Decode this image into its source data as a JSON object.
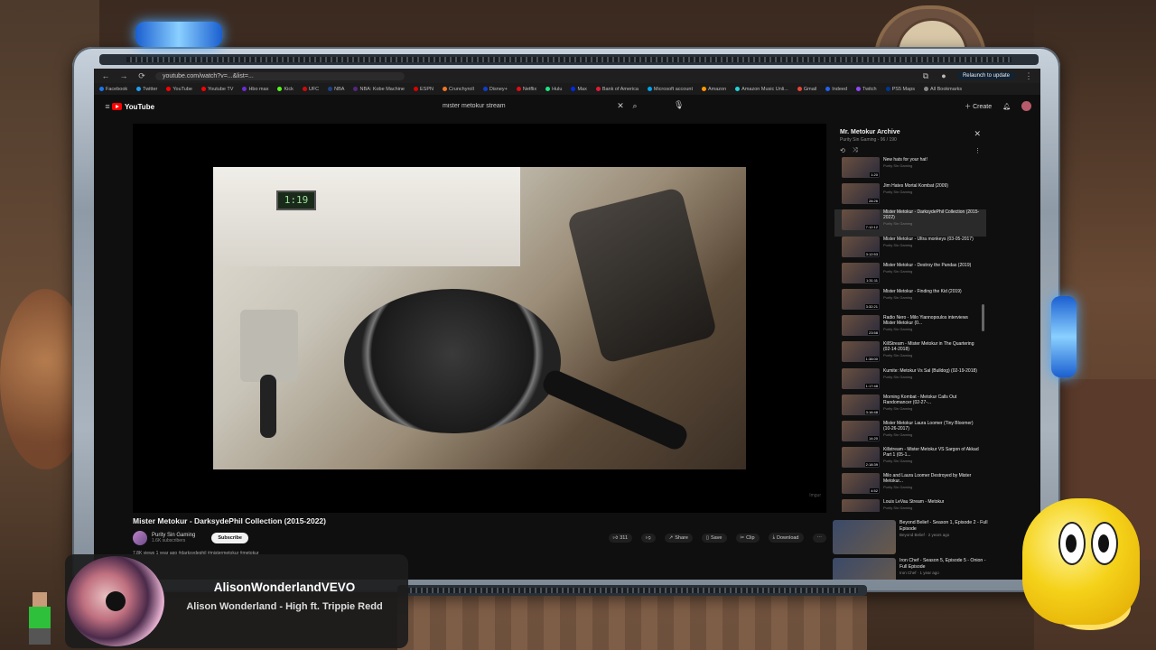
{
  "browser": {
    "url": "youtube.com/watch?v=...&list=...",
    "relaunch_label": "Relaunch to update",
    "bookmarks": [
      {
        "label": "Facebook",
        "color": "#1877f2"
      },
      {
        "label": "Twitter",
        "color": "#1da1f2"
      },
      {
        "label": "YouTube",
        "color": "#ff0000"
      },
      {
        "label": "Youtube TV",
        "color": "#ff0000"
      },
      {
        "label": "Hbo max",
        "color": "#6b2dd6"
      },
      {
        "label": "Kick",
        "color": "#53fc18"
      },
      {
        "label": "UFC",
        "color": "#d20a0a"
      },
      {
        "label": "NBA",
        "color": "#1d428a"
      },
      {
        "label": "NBA: Kobe Machine",
        "color": "#552583"
      },
      {
        "label": "ESPN",
        "color": "#d00"
      },
      {
        "label": "Crunchyroll",
        "color": "#f47521"
      },
      {
        "label": "Disney+",
        "color": "#113ccf"
      },
      {
        "label": "Netflix",
        "color": "#e50914"
      },
      {
        "label": "Hulu",
        "color": "#1ce783"
      },
      {
        "label": "Max",
        "color": "#002be7"
      },
      {
        "label": "Bank of America",
        "color": "#e31837"
      },
      {
        "label": "Microsoft account",
        "color": "#00a4ef"
      },
      {
        "label": "Amazon",
        "color": "#ff9900"
      },
      {
        "label": "Amazon Music Unli...",
        "color": "#25d1da"
      },
      {
        "label": "Gmail",
        "color": "#ea4335"
      },
      {
        "label": "Indeed",
        "color": "#2164f3"
      },
      {
        "label": "Twitch",
        "color": "#9146ff"
      },
      {
        "label": "PS5 Maps",
        "color": "#003791"
      },
      {
        "label": "All Bookmarks",
        "color": "#888888"
      }
    ]
  },
  "youtube": {
    "logo_text": "YouTube",
    "search_value": "mister metokur stream",
    "create_label": "Create"
  },
  "video": {
    "timer_display": "1:19",
    "watermark": "Imgur",
    "title": "Mister Metokur - DarksydePhil Collection (2015-2022)",
    "channel_name": "Purity Sin Gaming",
    "subscribers": "1.6K subscribers",
    "subscribe_label": "Subscribe",
    "likes": "311",
    "share_label": "Share",
    "save_label": "Save",
    "clip_label": "Clip",
    "download_label": "Download",
    "description_line": "7.8K views  1 year ago  #darksydephil #mistermetokur #metokur"
  },
  "playlist": {
    "title": "Mr. Metokur Archive",
    "subtitle": "Purity Sin Gaming - 96 / 190",
    "items": [
      {
        "title": "New hats for your hat!",
        "channel": "Purity Sin Gaming",
        "duration": "1:20",
        "active": false
      },
      {
        "title": "Jim Hates Mortal Kombat (2009)",
        "channel": "Purity Sin Gaming",
        "duration": "28:26",
        "active": false
      },
      {
        "title": "Mister Metokur - DarksydePhil Collection (2015-2022)",
        "channel": "Purity Sin Gaming",
        "duration": "7:12:12",
        "active": true
      },
      {
        "title": "Mister Metokur - Ultra monkeys (03-05-2017)",
        "channel": "Purity Sin Gaming",
        "duration": "3:12:53",
        "active": false
      },
      {
        "title": "Mister Metokur - Destroy the Pandas (2019)",
        "channel": "Purity Sin Gaming",
        "duration": "1:31:11",
        "active": false
      },
      {
        "title": "Mister Metokur - Finding the Kid (2019)",
        "channel": "Purity Sin Gaming",
        "duration": "3:32:21",
        "active": false
      },
      {
        "title": "Radio Nero - Milo Yiannopoulos interviews Mister Metokur (0...",
        "channel": "Purity Sin Gaming",
        "duration": "23:58",
        "active": false
      },
      {
        "title": "KillStream - Mister Metokur in The Quartering (02-14-2018)",
        "channel": "Purity Sin Gaming",
        "duration": "1:38:00",
        "active": false
      },
      {
        "title": "Kumite: Metokur Vs Sal (Bulldog) (02-19-2018)",
        "channel": "Purity Sin Gaming",
        "duration": "1:17:48",
        "active": false
      },
      {
        "title": "Morning Kombat - Metokur Calls Out Randomancer (02-27-...",
        "channel": "Purity Sin Gaming",
        "duration": "3:16:48",
        "active": false
      },
      {
        "title": "Mister Metokur Laura Loomer (Tiny Bloomer) (10-26-2017)",
        "channel": "Purity Sin Gaming",
        "duration": "14:20",
        "active": false
      },
      {
        "title": "Killstream - Mister Metokur VS Sargon of Akkad Part 1 (05-1...",
        "channel": "Purity Sin Gaming",
        "duration": "2:18:39",
        "active": false
      },
      {
        "title": "Milo and Laura Loomer Destroyed by Mister Metokur...",
        "channel": "Purity Sin Gaming",
        "duration": "4:52",
        "active": false
      },
      {
        "title": "Louis LeVau Stream - Metokur",
        "channel": "Purity Sin Gaming",
        "duration": "",
        "active": false
      }
    ],
    "recommended": [
      {
        "title": "Beyond Belief - Season 1, Episode 2 - Full Episode",
        "meta": "Beyond Belief  ·  2 years ago"
      },
      {
        "title": "Iron Chef - Season 5, Episode 5 - Onion - Full Episode",
        "meta": "Iron Chef  ·  1 year ago"
      }
    ]
  },
  "now_playing": {
    "artist": "AlisonWonderlandVEVO",
    "song": "Alison Wonderland - High ft. Trippie Redd"
  },
  "colors": {
    "accent_blue": "#4aa8ff",
    "youtube_red": "#ff0000",
    "koopa_yellow": "#f5d21a"
  }
}
